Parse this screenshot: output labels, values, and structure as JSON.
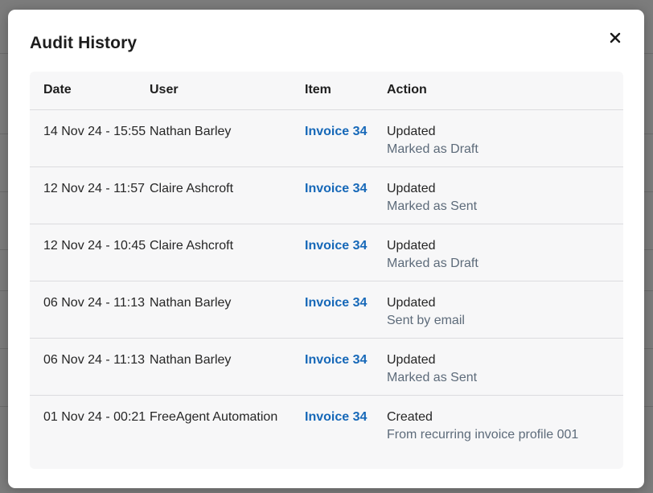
{
  "modal": {
    "title": "Audit History",
    "close_icon": "close-icon"
  },
  "table": {
    "headers": [
      "Date",
      "User",
      "Item",
      "Action"
    ],
    "rows": [
      {
        "date": "14 Nov 24 - 15:55",
        "user": "Nathan Barley",
        "item": "Invoice 34",
        "action": "Updated",
        "detail": "Marked as Draft"
      },
      {
        "date": "12 Nov 24 - 11:57",
        "user": "Claire Ashcroft",
        "item": "Invoice 34",
        "action": "Updated",
        "detail": "Marked as Sent"
      },
      {
        "date": "12 Nov 24 - 10:45",
        "user": "Claire Ashcroft",
        "item": "Invoice 34",
        "action": "Updated",
        "detail": "Marked as Draft"
      },
      {
        "date": "06 Nov 24 - 11:13",
        "user": "Nathan Barley",
        "item": "Invoice 34",
        "action": "Updated",
        "detail": "Sent by email"
      },
      {
        "date": "06 Nov 24 - 11:13",
        "user": "Nathan Barley",
        "item": "Invoice 34",
        "action": "Updated",
        "detail": "Marked as Sent"
      },
      {
        "date": "01 Nov 24 - 00:21",
        "user": "FreeAgent Automation",
        "item": "Invoice 34",
        "action": "Created",
        "detail": "From recurring invoice profile 001"
      }
    ]
  },
  "colors": {
    "link": "#1668b8",
    "detail_text": "#5d6b7a",
    "backdrop": "#7c7c7c"
  }
}
